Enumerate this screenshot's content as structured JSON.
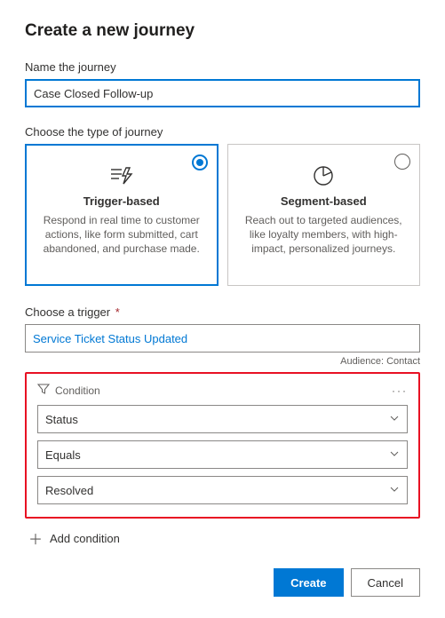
{
  "page_title": "Create a new journey",
  "name_section": {
    "label": "Name the journey",
    "value": "Case Closed Follow-up"
  },
  "type_section": {
    "label": "Choose the type of journey",
    "cards": [
      {
        "title": "Trigger-based",
        "desc": "Respond in real time to customer actions, like form submitted, cart abandoned, and purchase made.",
        "selected": true
      },
      {
        "title": "Segment-based",
        "desc": "Reach out to targeted audiences, like loyalty members, with high-impact, personalized journeys.",
        "selected": false
      }
    ]
  },
  "trigger_section": {
    "label": "Choose a trigger",
    "required_mark": "*",
    "value": "Service Ticket Status Updated",
    "audience_label": "Audience: Contact"
  },
  "condition": {
    "header": "Condition",
    "more": "···",
    "fields": {
      "attribute": "Status",
      "operator": "Equals",
      "value": "Resolved"
    }
  },
  "add_condition_label": "Add condition",
  "buttons": {
    "create": "Create",
    "cancel": "Cancel"
  }
}
